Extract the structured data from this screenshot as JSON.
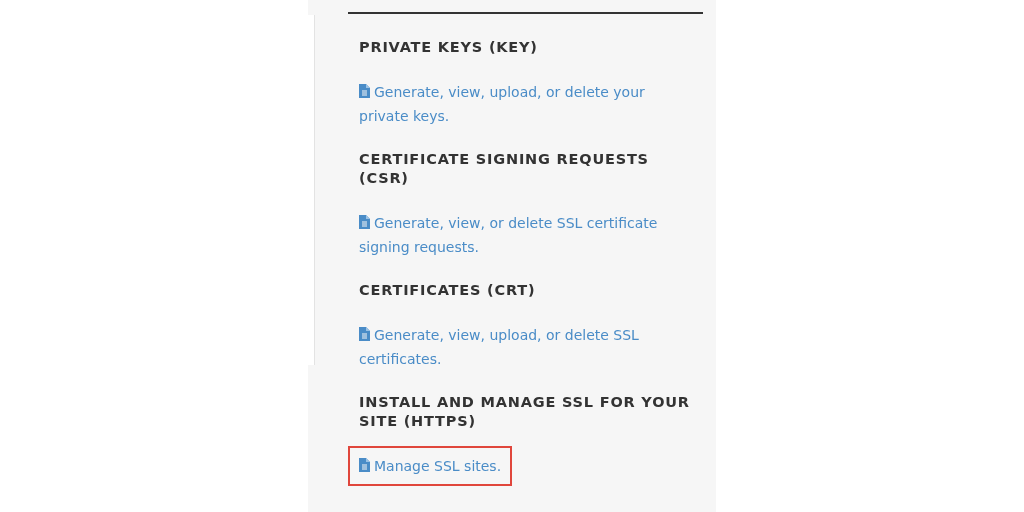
{
  "sections": [
    {
      "heading": "PRIVATE KEYS (KEY)",
      "link": {
        "text": "Generate, view, upload, or delete your private keys.",
        "highlighted": false
      }
    },
    {
      "heading": "CERTIFICATE SIGNING REQUESTS (CSR)",
      "link": {
        "text": "Generate, view, or delete SSL certificate signing requests.",
        "highlighted": false
      }
    },
    {
      "heading": "CERTIFICATES (CRT)",
      "link": {
        "text": "Generate, view, upload, or delete SSL certificates.",
        "highlighted": false
      }
    },
    {
      "heading": "INSTALL AND MANAGE SSL FOR YOUR SITE (HTTPS)",
      "link": {
        "text": "Manage SSL sites.",
        "highlighted": true
      }
    }
  ]
}
